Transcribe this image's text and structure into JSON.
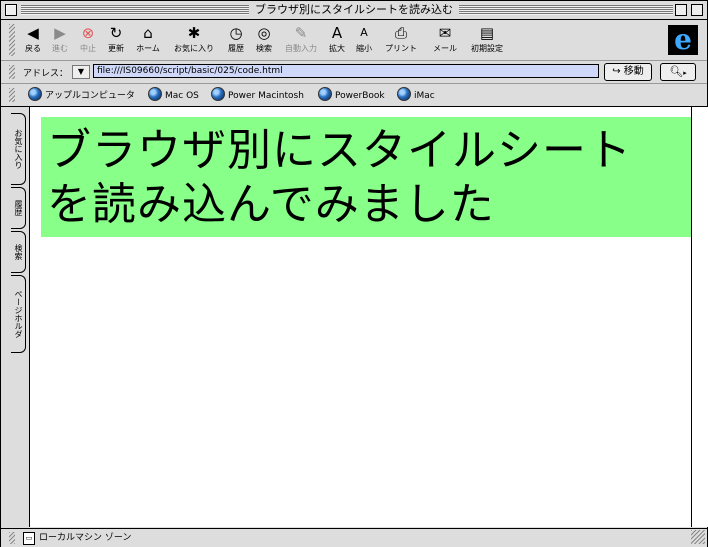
{
  "window": {
    "title": "ブラウザ別にスタイルシートを読み込む"
  },
  "toolbar": {
    "buttons": [
      {
        "label": "戻る"
      },
      {
        "label": "進む"
      },
      {
        "label": "中止"
      },
      {
        "label": "更新"
      },
      {
        "label": "ホーム"
      },
      {
        "label": "お気に入り"
      },
      {
        "label": "履歴"
      },
      {
        "label": "検索"
      },
      {
        "label": "自動入力"
      },
      {
        "label": "拡大"
      },
      {
        "label": "縮小"
      },
      {
        "label": "プリント"
      },
      {
        "label": "メール"
      },
      {
        "label": "初期設定"
      }
    ],
    "logo": "e"
  },
  "address": {
    "label": "アドレス：",
    "url": "file:///IS09660/script/basic/025/code.html",
    "go_label": "移動"
  },
  "favorites": {
    "items": [
      {
        "label": "アップルコンピュータ"
      },
      {
        "label": "Mac OS"
      },
      {
        "label": "Power Macintosh"
      },
      {
        "label": "PowerBook"
      },
      {
        "label": "iMac"
      }
    ]
  },
  "explorer_tabs": [
    {
      "label": "お気に入り"
    },
    {
      "label": "履歴"
    },
    {
      "label": "検索"
    },
    {
      "label": "ページホルダ"
    }
  ],
  "content": {
    "heading_line1": "ブラウザ別にスタイルシート",
    "heading_line2": "を読み込んでみました",
    "heading_bg": "#88ff88"
  },
  "status": {
    "text": "ローカルマシン ゾーン"
  }
}
